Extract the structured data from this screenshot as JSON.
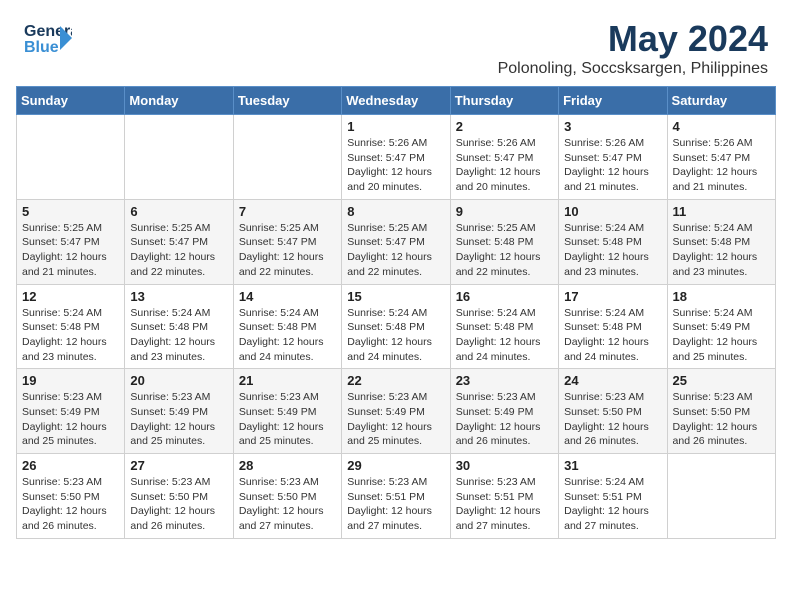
{
  "header": {
    "logo_general": "General",
    "logo_blue": "Blue",
    "month": "May 2024",
    "location": "Polonoling, Soccsksargen, Philippines"
  },
  "weekdays": [
    "Sunday",
    "Monday",
    "Tuesday",
    "Wednesday",
    "Thursday",
    "Friday",
    "Saturday"
  ],
  "weeks": [
    [
      {
        "day": "",
        "info": ""
      },
      {
        "day": "",
        "info": ""
      },
      {
        "day": "",
        "info": ""
      },
      {
        "day": "1",
        "info": "Sunrise: 5:26 AM\nSunset: 5:47 PM\nDaylight: 12 hours\nand 20 minutes."
      },
      {
        "day": "2",
        "info": "Sunrise: 5:26 AM\nSunset: 5:47 PM\nDaylight: 12 hours\nand 20 minutes."
      },
      {
        "day": "3",
        "info": "Sunrise: 5:26 AM\nSunset: 5:47 PM\nDaylight: 12 hours\nand 21 minutes."
      },
      {
        "day": "4",
        "info": "Sunrise: 5:26 AM\nSunset: 5:47 PM\nDaylight: 12 hours\nand 21 minutes."
      }
    ],
    [
      {
        "day": "5",
        "info": "Sunrise: 5:25 AM\nSunset: 5:47 PM\nDaylight: 12 hours\nand 21 minutes."
      },
      {
        "day": "6",
        "info": "Sunrise: 5:25 AM\nSunset: 5:47 PM\nDaylight: 12 hours\nand 22 minutes."
      },
      {
        "day": "7",
        "info": "Sunrise: 5:25 AM\nSunset: 5:47 PM\nDaylight: 12 hours\nand 22 minutes."
      },
      {
        "day": "8",
        "info": "Sunrise: 5:25 AM\nSunset: 5:47 PM\nDaylight: 12 hours\nand 22 minutes."
      },
      {
        "day": "9",
        "info": "Sunrise: 5:25 AM\nSunset: 5:48 PM\nDaylight: 12 hours\nand 22 minutes."
      },
      {
        "day": "10",
        "info": "Sunrise: 5:24 AM\nSunset: 5:48 PM\nDaylight: 12 hours\nand 23 minutes."
      },
      {
        "day": "11",
        "info": "Sunrise: 5:24 AM\nSunset: 5:48 PM\nDaylight: 12 hours\nand 23 minutes."
      }
    ],
    [
      {
        "day": "12",
        "info": "Sunrise: 5:24 AM\nSunset: 5:48 PM\nDaylight: 12 hours\nand 23 minutes."
      },
      {
        "day": "13",
        "info": "Sunrise: 5:24 AM\nSunset: 5:48 PM\nDaylight: 12 hours\nand 23 minutes."
      },
      {
        "day": "14",
        "info": "Sunrise: 5:24 AM\nSunset: 5:48 PM\nDaylight: 12 hours\nand 24 minutes."
      },
      {
        "day": "15",
        "info": "Sunrise: 5:24 AM\nSunset: 5:48 PM\nDaylight: 12 hours\nand 24 minutes."
      },
      {
        "day": "16",
        "info": "Sunrise: 5:24 AM\nSunset: 5:48 PM\nDaylight: 12 hours\nand 24 minutes."
      },
      {
        "day": "17",
        "info": "Sunrise: 5:24 AM\nSunset: 5:48 PM\nDaylight: 12 hours\nand 24 minutes."
      },
      {
        "day": "18",
        "info": "Sunrise: 5:24 AM\nSunset: 5:49 PM\nDaylight: 12 hours\nand 25 minutes."
      }
    ],
    [
      {
        "day": "19",
        "info": "Sunrise: 5:23 AM\nSunset: 5:49 PM\nDaylight: 12 hours\nand 25 minutes."
      },
      {
        "day": "20",
        "info": "Sunrise: 5:23 AM\nSunset: 5:49 PM\nDaylight: 12 hours\nand 25 minutes."
      },
      {
        "day": "21",
        "info": "Sunrise: 5:23 AM\nSunset: 5:49 PM\nDaylight: 12 hours\nand 25 minutes."
      },
      {
        "day": "22",
        "info": "Sunrise: 5:23 AM\nSunset: 5:49 PM\nDaylight: 12 hours\nand 25 minutes."
      },
      {
        "day": "23",
        "info": "Sunrise: 5:23 AM\nSunset: 5:49 PM\nDaylight: 12 hours\nand 26 minutes."
      },
      {
        "day": "24",
        "info": "Sunrise: 5:23 AM\nSunset: 5:50 PM\nDaylight: 12 hours\nand 26 minutes."
      },
      {
        "day": "25",
        "info": "Sunrise: 5:23 AM\nSunset: 5:50 PM\nDaylight: 12 hours\nand 26 minutes."
      }
    ],
    [
      {
        "day": "26",
        "info": "Sunrise: 5:23 AM\nSunset: 5:50 PM\nDaylight: 12 hours\nand 26 minutes."
      },
      {
        "day": "27",
        "info": "Sunrise: 5:23 AM\nSunset: 5:50 PM\nDaylight: 12 hours\nand 26 minutes."
      },
      {
        "day": "28",
        "info": "Sunrise: 5:23 AM\nSunset: 5:50 PM\nDaylight: 12 hours\nand 27 minutes."
      },
      {
        "day": "29",
        "info": "Sunrise: 5:23 AM\nSunset: 5:51 PM\nDaylight: 12 hours\nand 27 minutes."
      },
      {
        "day": "30",
        "info": "Sunrise: 5:23 AM\nSunset: 5:51 PM\nDaylight: 12 hours\nand 27 minutes."
      },
      {
        "day": "31",
        "info": "Sunrise: 5:24 AM\nSunset: 5:51 PM\nDaylight: 12 hours\nand 27 minutes."
      },
      {
        "day": "",
        "info": ""
      }
    ]
  ]
}
